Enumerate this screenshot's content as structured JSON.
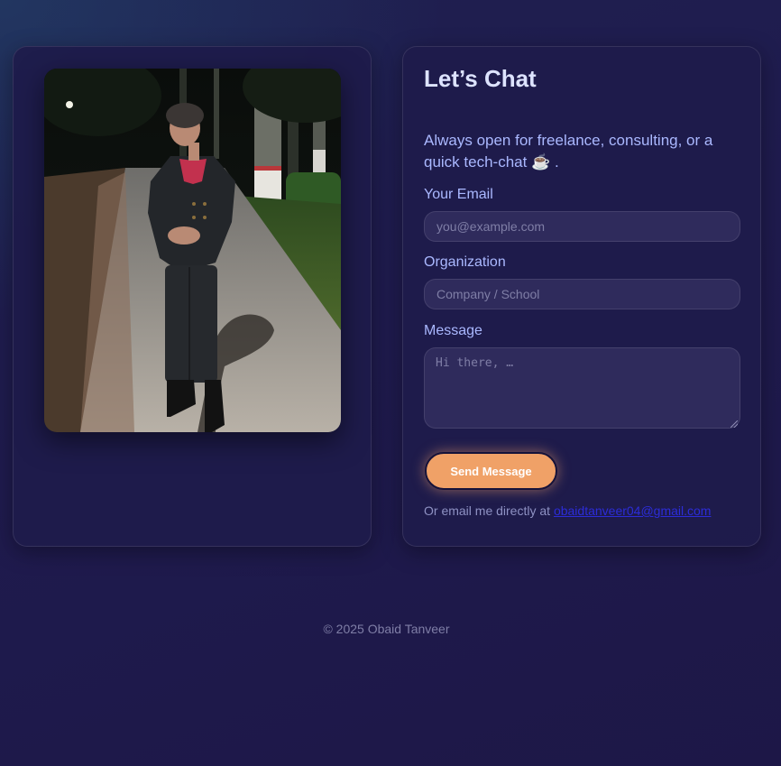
{
  "contact": {
    "title": "Let’s Chat",
    "intro": "Always open for freelance, consulting, or a quick tech-chat ☕ .",
    "fields": {
      "email_label": "Your Email",
      "email_placeholder": "you@example.com",
      "org_label": "Organization",
      "org_placeholder": "Company / School",
      "message_label": "Message",
      "message_placeholder": "Hi there, …"
    },
    "send_label": "Send Message",
    "direct_text": "Or email me directly at",
    "direct_email": "obaidtanveer04@gmail.com"
  },
  "footer": {
    "copyright": "© 2025 Obaid Tanveer"
  },
  "colors": {
    "accent": "#f0a167",
    "label": "#aab8ff",
    "card_bg": "#1e1b4b"
  }
}
